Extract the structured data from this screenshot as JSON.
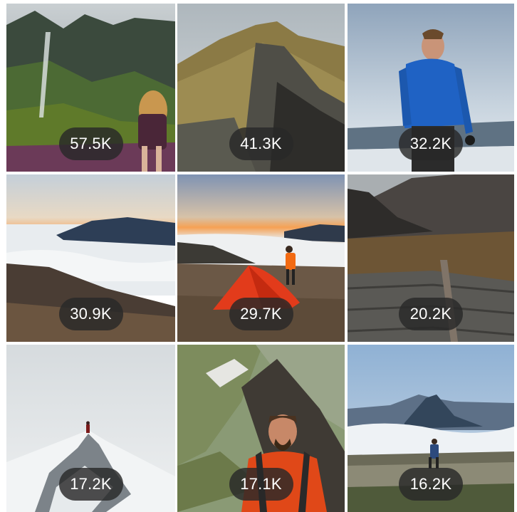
{
  "grid": {
    "tiles": [
      {
        "count": "57.5K",
        "icon": "mountain-waterfall-woman-photo"
      },
      {
        "count": "41.3K",
        "icon": "mountain-ridge-photo"
      },
      {
        "count": "32.2K",
        "icon": "hiker-blue-jacket-photo"
      },
      {
        "count": "30.9K",
        "icon": "cloud-inversion-sunset-photo"
      },
      {
        "count": "29.7K",
        "icon": "red-tent-camp-photo"
      },
      {
        "count": "20.2K",
        "icon": "stone-wall-mountain-photo"
      },
      {
        "count": "17.2K",
        "icon": "snowy-ridge-hiker-photo"
      },
      {
        "count": "17.1K",
        "icon": "smiling-climber-ridge-photo"
      },
      {
        "count": "16.2K",
        "icon": "pyramid-peak-hiker-photo"
      }
    ]
  },
  "colors": {
    "badge_background": "#282828",
    "badge_text": "#ffffff",
    "background": "#ffffff"
  }
}
